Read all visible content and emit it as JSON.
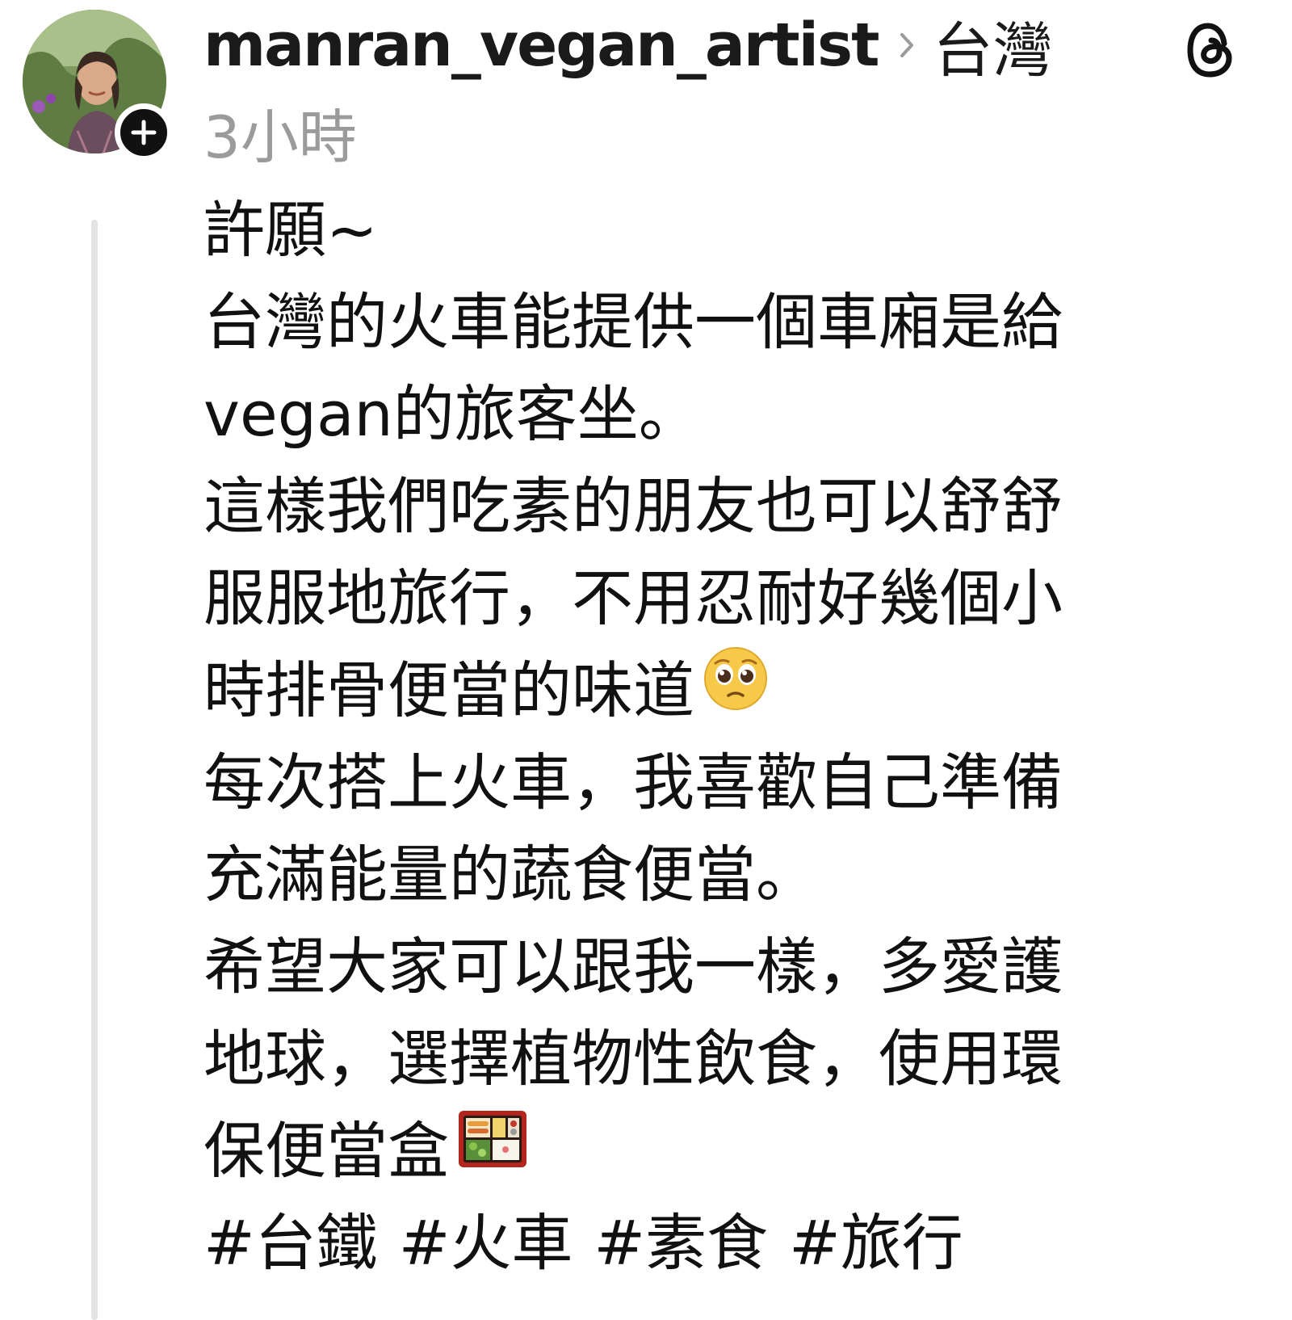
{
  "post": {
    "username": "manran_vegan_artist",
    "location": "台灣",
    "timestamp": "3小時",
    "lines": [
      "許願~",
      "台灣的火車能提供一個車廂是給",
      "vegan的旅客坐。",
      "這樣我們吃素的朋友也可以舒舒",
      "服服地旅行，不用忍耐好幾個小",
      "時排骨便當的味道",
      "每次搭上火車，我喜歡自己準備",
      "充滿能量的蔬食便當。",
      "希望大家可以跟我一樣，多愛護",
      "地球，選擇植物性飲食，使用環",
      "保便當盒"
    ],
    "emojis": {
      "line_6": "pleading-face-emoji",
      "line_11": "bento-box-emoji"
    },
    "hashtags": [
      "#台鐵",
      "#火車",
      "#素食",
      "#旅行"
    ]
  },
  "icons": {
    "avatar": "profile-photo",
    "follow": "plus-icon",
    "separator": "chevron-right-icon",
    "app": "threads-logo-icon"
  },
  "colors": {
    "text": "#111111",
    "muted": "#9b9b9b",
    "thread_line": "#e3e3e3",
    "badge": "#111111"
  }
}
